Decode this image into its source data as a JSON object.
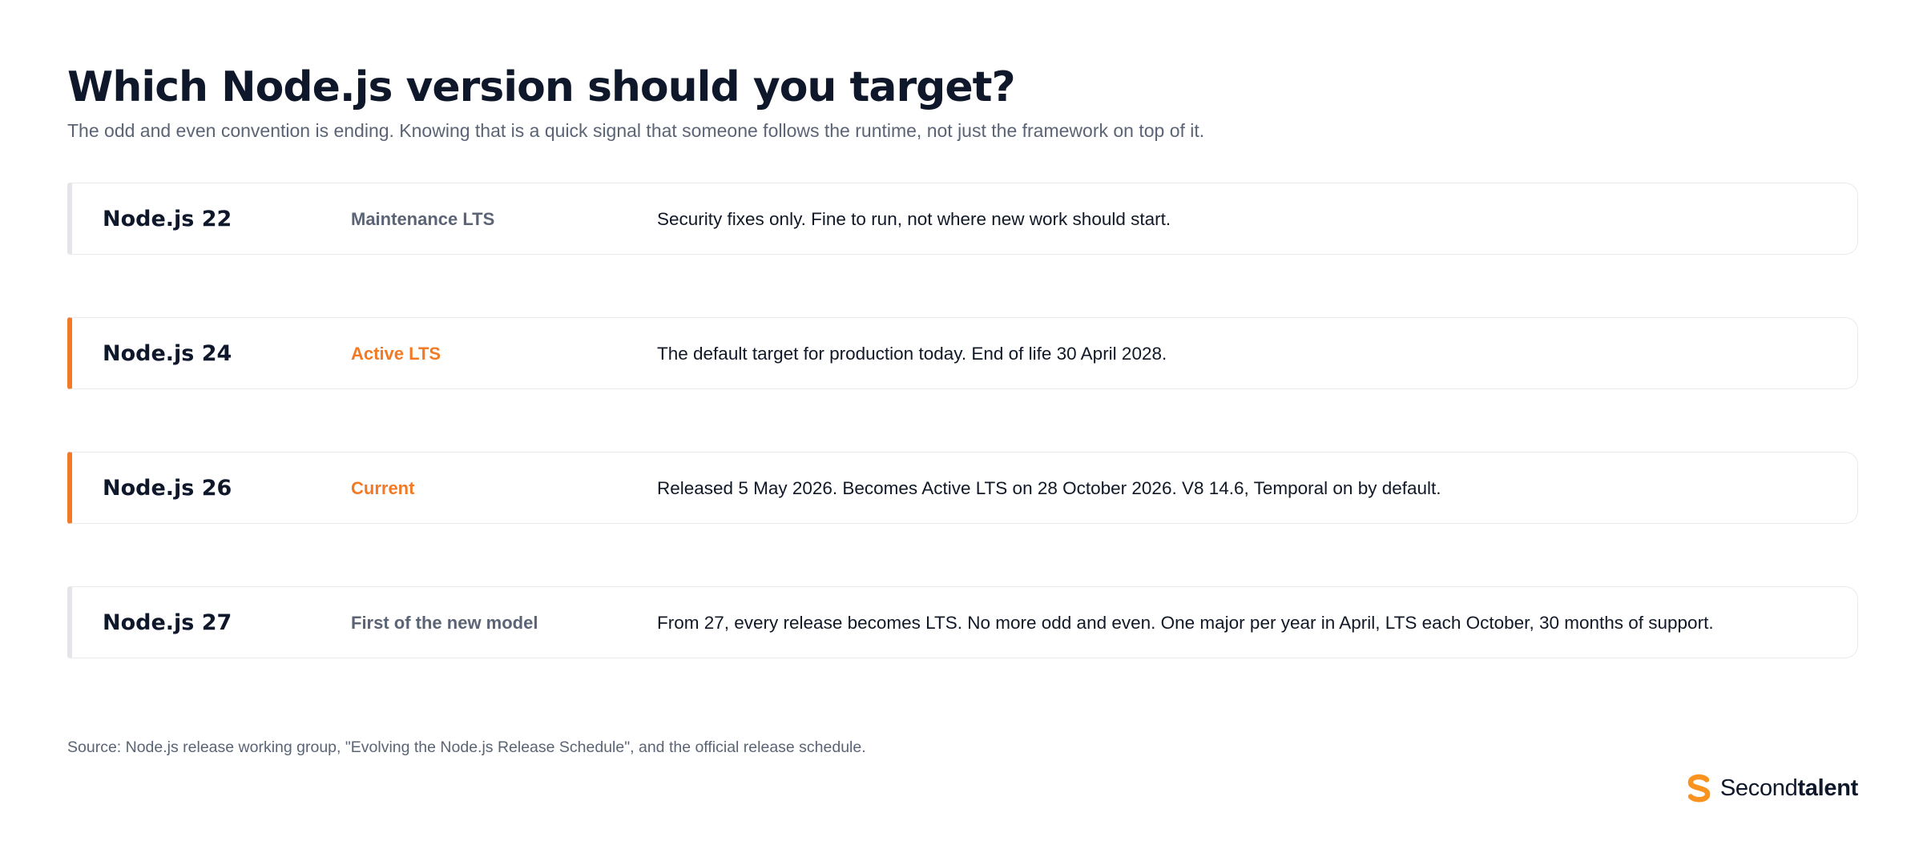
{
  "header": {
    "title": "Which Node.js version should you target?",
    "subtitle": "The odd and even convention is ending. Knowing that is a quick signal that someone follows the runtime, not just the framework on top of it."
  },
  "rows": [
    {
      "version": "Node.js 22",
      "status": "Maintenance LTS",
      "description": "Security fixes only. Fine to run, not where new work should start.",
      "highlighted": false
    },
    {
      "version": "Node.js 24",
      "status": "Active LTS",
      "description": "The default target for production today. End of life 30 April 2028.",
      "highlighted": true
    },
    {
      "version": "Node.js 26",
      "status": "Current",
      "description": "Released 5 May 2026. Becomes Active LTS on 28 October 2026. V8 14.6, Temporal on by default.",
      "highlighted": true
    },
    {
      "version": "Node.js 27",
      "status": "First of the new model",
      "description": "From 27, every release becomes LTS. No more odd and even. One major per year in April, LTS each October, 30 months of support.",
      "highlighted": false
    }
  ],
  "footer": {
    "source": "Source: Node.js release working group, \"Evolving the Node.js Release Schedule\", and the official release schedule."
  },
  "brand": {
    "name_light": "Second",
    "name_bold": "talent",
    "icon": "secondtalent-logo-icon"
  },
  "colors": {
    "accent": "#f27a26",
    "text_dark": "#0f172a",
    "text_muted": "#5b6475",
    "row_border": "#e8eaee"
  }
}
